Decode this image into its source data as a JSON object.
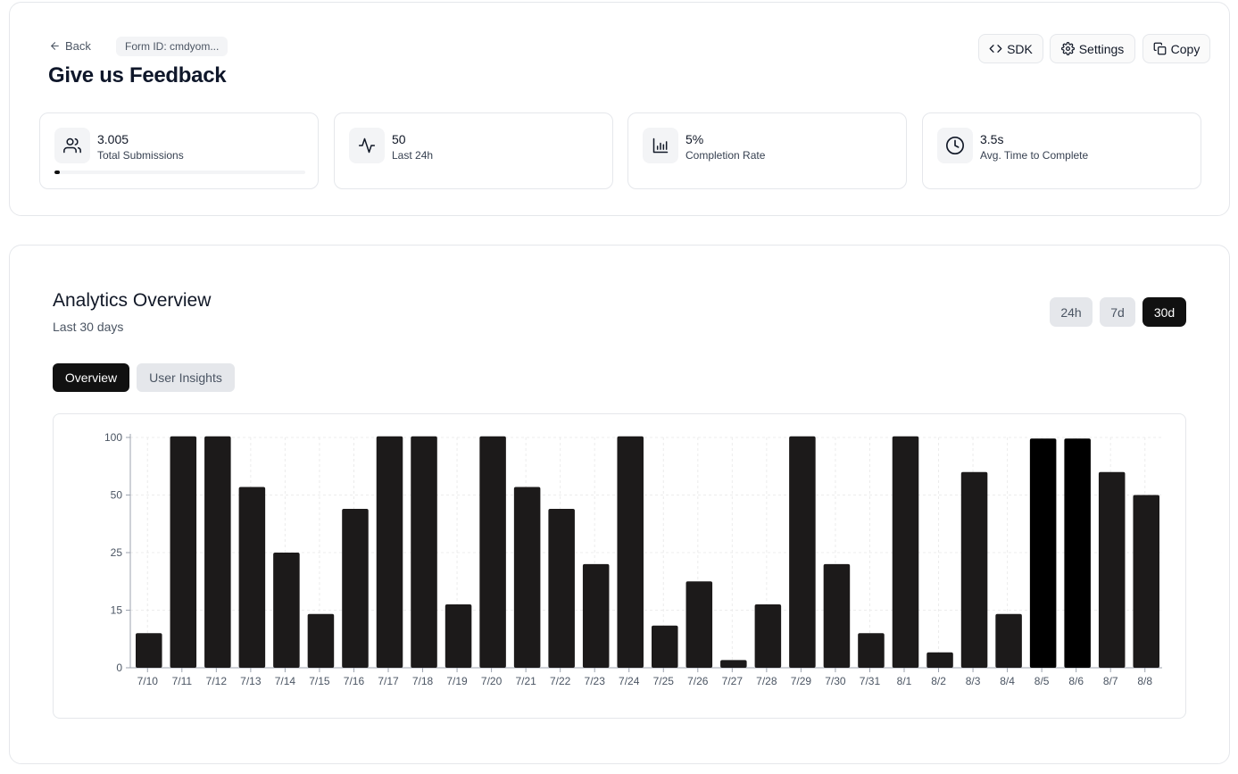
{
  "header": {
    "back_label": "Back",
    "form_id": "Form ID: cmdyom...",
    "title": "Give us Feedback",
    "buttons": {
      "sdk": "SDK",
      "settings": "Settings",
      "copy": "Copy"
    }
  },
  "stats": [
    {
      "value": "3.005",
      "label": "Total Submissions",
      "icon": "users-icon",
      "progress": 0.02
    },
    {
      "value": "50",
      "label": "Last 24h",
      "icon": "activity-icon"
    },
    {
      "value": "5%",
      "label": "Completion Rate",
      "icon": "bar-chart-icon"
    },
    {
      "value": "3.5s",
      "label": "Avg. Time to Complete",
      "icon": "clock-icon"
    }
  ],
  "analytics": {
    "title": "Analytics Overview",
    "subtitle": "Last 30 days",
    "ranges": [
      "24h",
      "7d",
      "30d"
    ],
    "selected_range": "30d",
    "tabs": [
      "Overview",
      "User Insights"
    ],
    "selected_tab": "Overview"
  },
  "colors": {
    "bar": "#1c1a1a",
    "bar_highlight": "#000000",
    "active": "#111111",
    "muted_bg": "#e5e7eb"
  },
  "chart_data": {
    "type": "bar",
    "title": "",
    "xlabel": "",
    "ylabel": "",
    "y_ticks": [
      0,
      15,
      25,
      50,
      100
    ],
    "y_scale": "piecewise (ticks evenly spaced)",
    "grid": true,
    "categories": [
      "7/10",
      "7/11",
      "7/12",
      "7/13",
      "7/14",
      "7/15",
      "7/16",
      "7/17",
      "7/18",
      "7/19",
      "7/20",
      "7/21",
      "7/22",
      "7/23",
      "7/24",
      "7/25",
      "7/26",
      "7/27",
      "7/28",
      "7/29",
      "7/30",
      "7/31",
      "8/1",
      "8/2",
      "8/3",
      "8/4",
      "8/5",
      "8/6",
      "8/7",
      "8/8"
    ],
    "values": [
      9,
      101,
      101,
      57,
      25,
      14,
      44,
      101,
      101,
      16,
      101,
      57,
      44,
      23,
      101,
      11,
      20,
      2,
      16,
      101,
      23,
      9,
      101,
      4,
      70,
      14,
      99,
      99,
      70,
      50
    ],
    "highlighted": [
      "8/5",
      "8/6"
    ]
  }
}
